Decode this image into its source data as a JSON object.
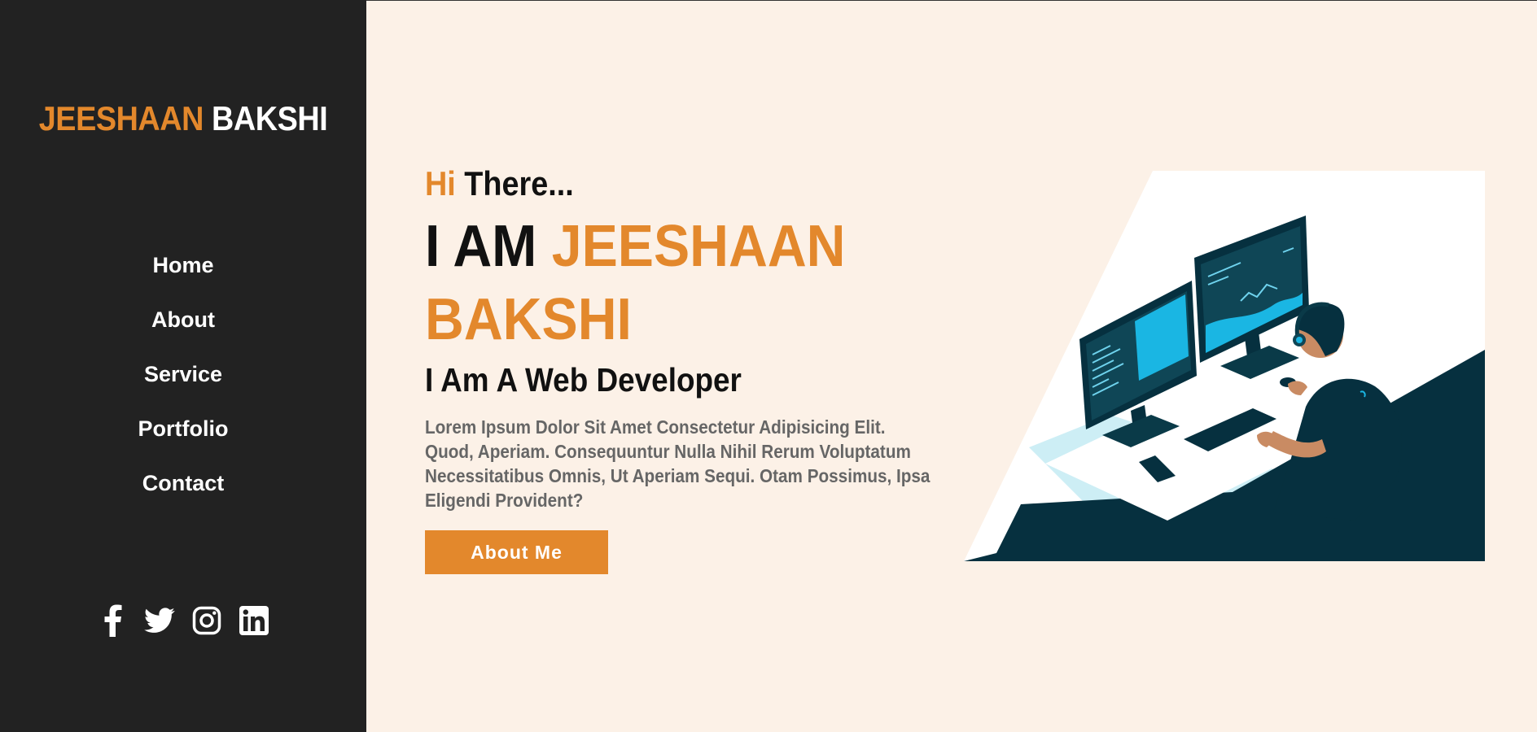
{
  "brand": {
    "first": "JEESHAAN",
    "last": "BAKSHI"
  },
  "nav": {
    "items": [
      {
        "label": "Home"
      },
      {
        "label": "About"
      },
      {
        "label": "Service"
      },
      {
        "label": "Portfolio"
      },
      {
        "label": "Contact"
      }
    ]
  },
  "socials": [
    "facebook-icon",
    "twitter-icon",
    "instagram-icon",
    "linkedin-icon"
  ],
  "hero": {
    "greeting_hi": "Hi",
    "greeting_rest": "There...",
    "headline_prefix": "I AM",
    "headline_name": "JEESHAAN BAKSHI",
    "subtitle": "I Am A Web Developer",
    "description": "Lorem Ipsum Dolor Sit Amet Consectetur Adipisicing Elit. Quod, Aperiam. Consequuntur Nulla Nihil Rerum Voluptatum Necessitatibus Omnis, Ut Aperiam Sequi. Otam Possimus, Ipsa Eligendi Provident?",
    "cta_label": "About Me"
  },
  "colors": {
    "accent": "#e3882c",
    "sidebar_bg": "#222222",
    "page_bg": "#fcf1e7",
    "illustration_dark": "#06303f",
    "illustration_screen": "#1ab6e3"
  }
}
